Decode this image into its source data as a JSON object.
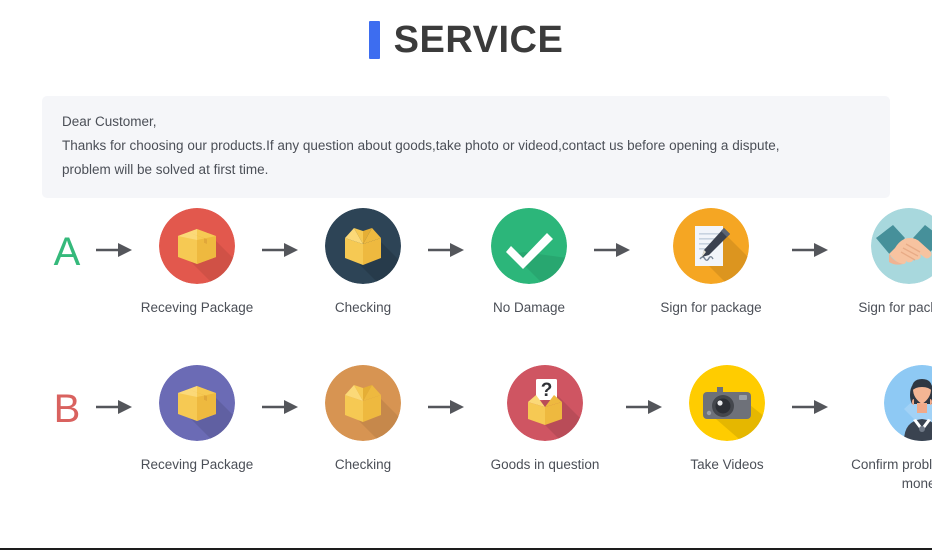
{
  "header": {
    "title": "SERVICE",
    "accent_color": "#3d6df0"
  },
  "notice": {
    "line1": "Dear Customer,",
    "line2": "Thanks for choosing our products.If any question about goods,take photo or videod,contact us before opening a dispute,",
    "line3": "problem will be solved at first time.",
    "background_color": "#f5f6f9",
    "text_color": "#4b4f57"
  },
  "flows": [
    {
      "letter": "A",
      "letter_color": "#35b97b",
      "steps": [
        {
          "label": "Receving Package",
          "icon": "closed-box-icon",
          "circle_color": "#e2584d"
        },
        {
          "label": "Checking",
          "icon": "open-box-icon",
          "circle_color": "#2d4456"
        },
        {
          "label": "No Damage",
          "icon": "check-mark-icon",
          "circle_color": "#2cb67a"
        },
        {
          "label": "Sign for package",
          "icon": "document-pen-icon",
          "circle_color": "#f5a623"
        },
        {
          "label": "Sign for package",
          "icon": "handshake-icon",
          "circle_color": "#a8d8dd"
        }
      ]
    },
    {
      "letter": "B",
      "letter_color": "#d9625f",
      "steps": [
        {
          "label": "Receving Package",
          "icon": "closed-box-icon",
          "circle_color": "#6b6bb5"
        },
        {
          "label": "Checking",
          "icon": "open-box-icon",
          "circle_color": "#d79452"
        },
        {
          "label": "Goods in question",
          "icon": "question-box-icon",
          "circle_color": "#cf5562"
        },
        {
          "label": "Take Videos",
          "icon": "camera-icon",
          "circle_color": "#ffcc00"
        },
        {
          "label": "Confirm problem,refund money",
          "icon": "support-agent-icon",
          "circle_color": "#8ec9f4"
        }
      ]
    }
  ],
  "arrow": {
    "name": "arrow-right-icon",
    "color": "#54565b"
  }
}
